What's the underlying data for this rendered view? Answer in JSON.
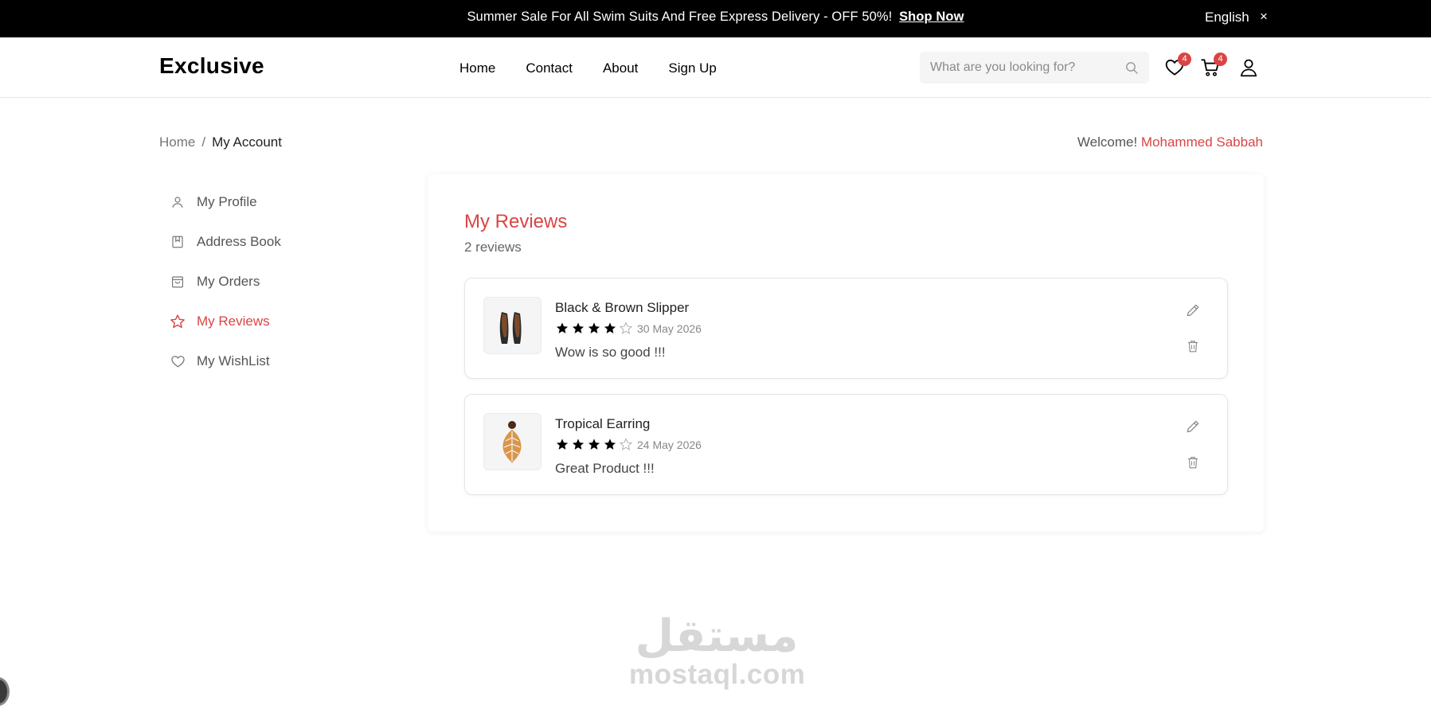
{
  "banner": {
    "message": "Summer Sale For All Swim Suits And Free Express Delivery - OFF 50%!",
    "link": "Shop Now",
    "language": "English",
    "close": "×"
  },
  "header": {
    "logo": "Exclusive",
    "nav": [
      "Home",
      "Contact",
      "About",
      "Sign Up"
    ],
    "search_placeholder": "What are you looking for?",
    "wishlist_count": "4",
    "cart_count": "4"
  },
  "breadcrumb": {
    "home": "Home",
    "separator": "/",
    "current": "My Account"
  },
  "welcome": {
    "prefix": "Welcome! ",
    "name": "Mohammed Sabbah"
  },
  "sidebar": {
    "items": [
      {
        "label": "My Profile",
        "icon": "user-icon"
      },
      {
        "label": "Address Book",
        "icon": "bookmark-icon"
      },
      {
        "label": "My Orders",
        "icon": "shopping-bag-icon"
      },
      {
        "label": "My Reviews",
        "icon": "star-icon",
        "active": true
      },
      {
        "label": "My WishList",
        "icon": "heart-icon"
      }
    ]
  },
  "reviews": {
    "title": "My Reviews",
    "count": "2 reviews",
    "items": [
      {
        "product": "Black & Brown Slipper",
        "rating": 4,
        "max_rating": 5,
        "date": "30 May 2026",
        "text": "Wow is so good !!!",
        "image": "slipper-image"
      },
      {
        "product": "Tropical Earring",
        "rating": 4,
        "max_rating": 5,
        "date": "24 May 2026",
        "text": "Great Product !!!",
        "image": "earring-image"
      }
    ]
  },
  "watermark": {
    "arabic": "مستقل",
    "latin": "mostaql.com"
  },
  "colors": {
    "accent": "#db4444",
    "banner_bg": "#000000",
    "text": "#222222",
    "muted": "#777777"
  }
}
